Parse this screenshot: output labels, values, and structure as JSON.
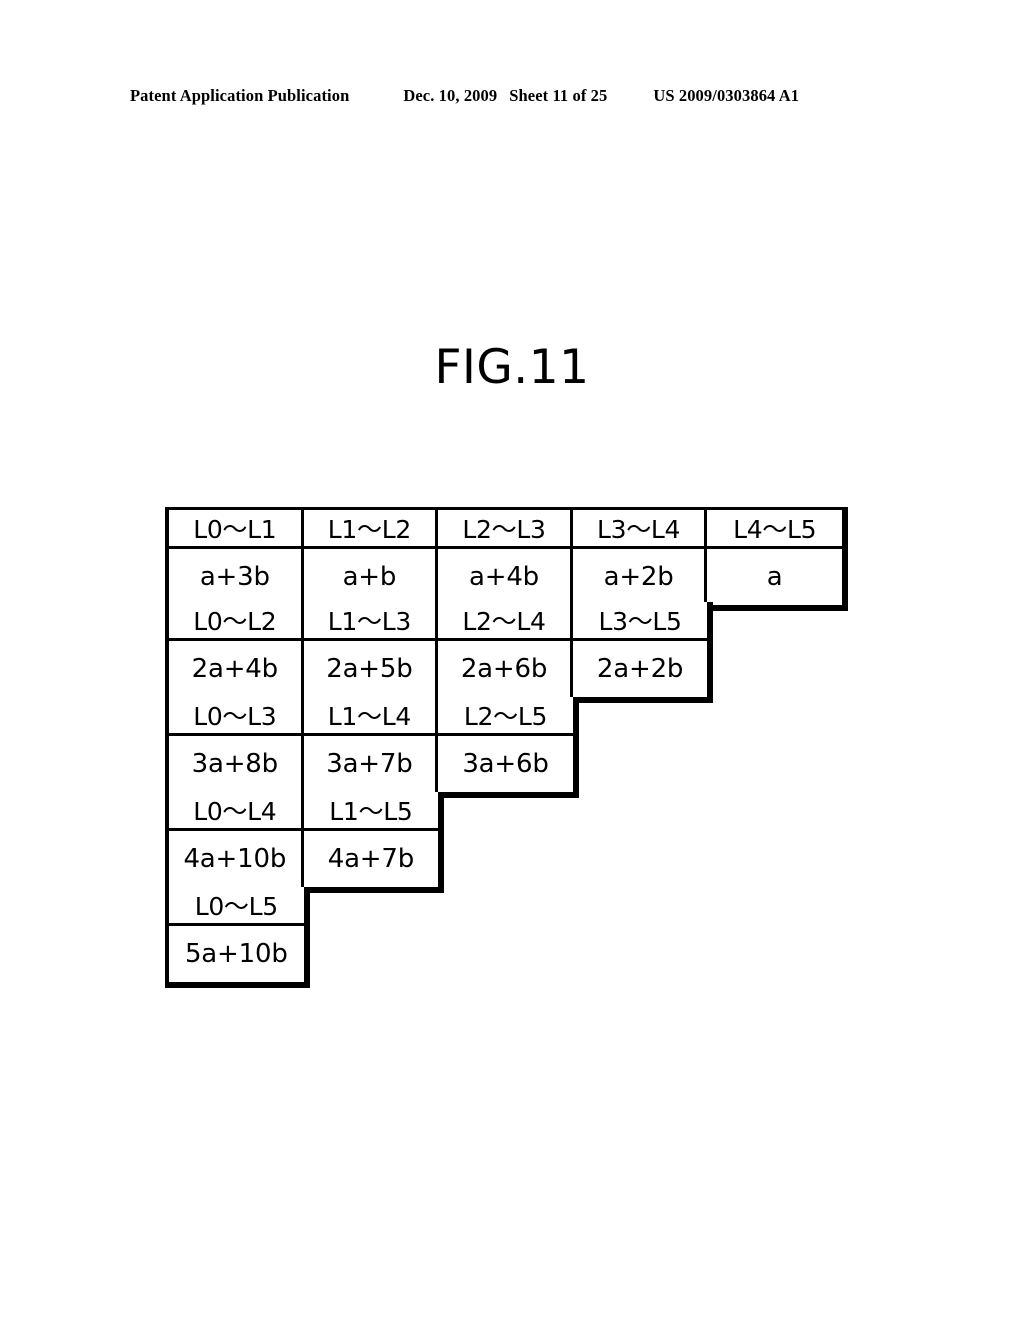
{
  "page_header": {
    "publication": "Patent Application Publication",
    "date": "Dec. 10, 2009",
    "sheet": "Sheet 11 of 25",
    "patent_number": "US 2009/0303864 A1"
  },
  "figure": {
    "title": "FIG.11",
    "colors": {
      "line": "#000000",
      "background": "#ffffff",
      "text": "#000000"
    },
    "blocks": [
      {
        "id": "block-1",
        "columns": 5,
        "labels": [
          "L0～L1",
          "L1～L2",
          "L2～L3",
          "L3～L4",
          "L4～L5"
        ],
        "values": [
          "a+3b",
          "a+b",
          "a+4b",
          "a+2b",
          "a"
        ]
      },
      {
        "id": "block-2",
        "columns": 4,
        "labels": [
          "L0～L2",
          "L1～L3",
          "L2～L4",
          "L3～L5"
        ],
        "values": [
          "2a+4b",
          "2a+5b",
          "2a+6b",
          "2a+2b"
        ]
      },
      {
        "id": "block-3",
        "columns": 3,
        "labels": [
          "L0～L3",
          "L1～L4",
          "L2～L5"
        ],
        "values": [
          "3a+8b",
          "3a+7b",
          "3a+6b"
        ]
      },
      {
        "id": "block-4",
        "columns": 2,
        "labels": [
          "L0～L4",
          "L1～L5"
        ],
        "values": [
          "4a+10b",
          "4a+7b"
        ]
      },
      {
        "id": "block-5",
        "columns": 1,
        "labels": [
          "L0～L5"
        ],
        "values": [
          "5a+10b"
        ]
      }
    ]
  }
}
